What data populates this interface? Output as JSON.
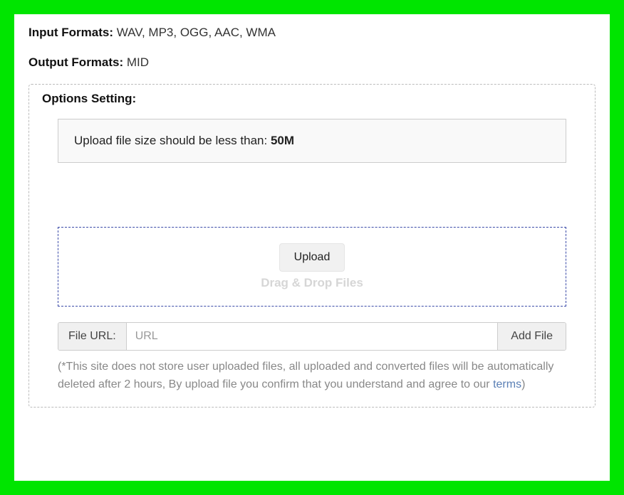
{
  "formats": {
    "input_label": "Input Formats: ",
    "input_value": "WAV, MP3, OGG, AAC, WMA",
    "output_label": "Output Formats: ",
    "output_value": "MID"
  },
  "options": {
    "title": "Options Setting:",
    "notice_text": "Upload file size should be less than: ",
    "notice_limit": "50M"
  },
  "dropzone": {
    "upload_button": "Upload",
    "dragdrop_text": "Drag & Drop Files"
  },
  "url_row": {
    "label": "File URL:",
    "placeholder": "URL",
    "value": "",
    "addfile_button": "Add File"
  },
  "disclaimer": {
    "prefix": "(*This site does not store user uploaded files, all uploaded and converted files will be automatically deleted after 2 hours, By upload file you confirm that you understand and agree to our ",
    "link_text": "terms",
    "suffix": ")"
  }
}
